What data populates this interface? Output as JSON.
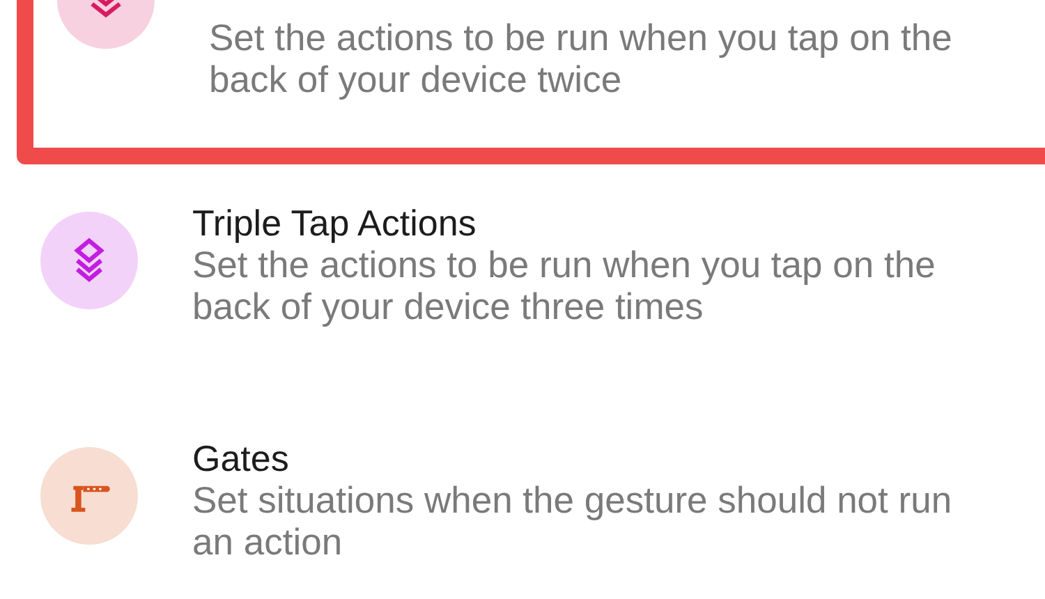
{
  "items": [
    {
      "kind": "double",
      "color": "#d81b60",
      "description": "Set the actions to be run when you tap on the back of your device twice",
      "highlighted": true
    },
    {
      "kind": "triple",
      "color": "#c21de0",
      "title": "Triple Tap Actions",
      "description": "Set the actions to be run when you tap on the back of your device three times",
      "highlighted": false
    },
    {
      "kind": "gate",
      "color": "#d9541e",
      "title": "Gates",
      "description": "Set situations when the gesture should not run an action",
      "highlighted": false
    }
  ]
}
